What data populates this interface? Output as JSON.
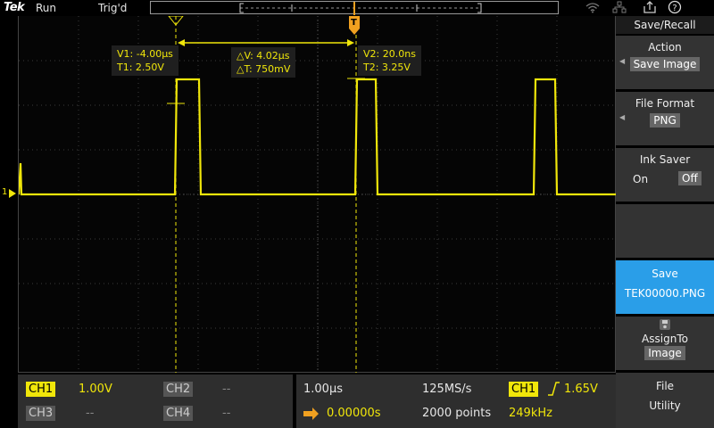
{
  "header": {
    "logo": "Tek",
    "run_state": "Run",
    "trigger_state": "Trig'd",
    "help_icon": "?"
  },
  "cursors": {
    "cursor1": {
      "v": "V1: -4.00µs",
      "t": "T1: 2.50V"
    },
    "delta": {
      "dv": "△V: 4.02µs",
      "dt": "△T: 750mV"
    },
    "cursor2": {
      "v": "V2: 20.0ns",
      "t": "T2: 3.25V"
    }
  },
  "channel_marker": "1",
  "trigger_marker": "T",
  "side_menu": {
    "title": "Save/Recall",
    "action_label": "Action",
    "action_value": "Save Image",
    "format_label": "File Format",
    "format_value": "PNG",
    "ink_label": "Ink Saver",
    "ink_on": "On",
    "ink_off": "Off",
    "save_label": "Save",
    "save_file": "TEK00000.PNG",
    "assign_label": "AssignTo",
    "assign_value": "Image",
    "file_label": "File",
    "utility_label": "Utility"
  },
  "bottom": {
    "ch1_label": "CH1",
    "ch1_scale": "1.00V",
    "ch2_label": "CH2",
    "ch2_scale": "--",
    "ch3_label": "CH3",
    "ch3_scale": "--",
    "ch4_label": "CH4",
    "ch4_scale": "--",
    "timebase": "1.00µs",
    "sample_rate": "125MS/s",
    "position": "0.00000s",
    "record_length": "2000 points",
    "trigger_source": "CH1",
    "trigger_level": "1.65V",
    "frequency": "249kHz"
  },
  "colors": {
    "trace": "#f0e60a",
    "save_button": "#2a9ee8",
    "trigger_marker": "#f0a020"
  }
}
